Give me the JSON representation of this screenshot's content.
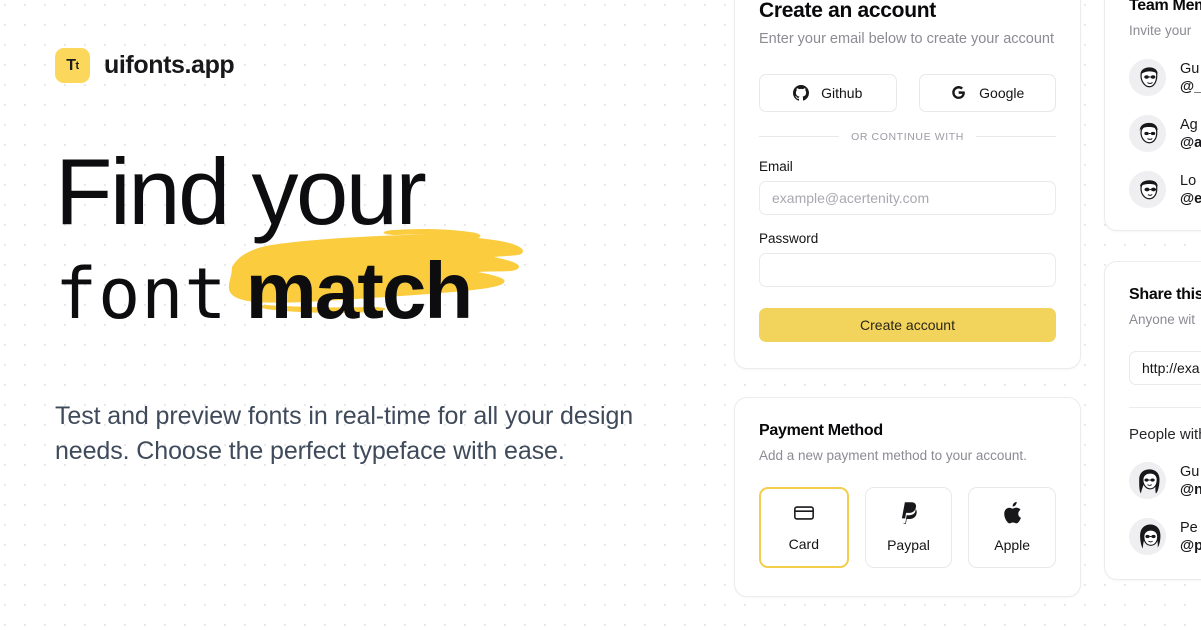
{
  "brand": {
    "mark_letter_1": "T",
    "mark_letter_2": "t",
    "name": "uifonts.app"
  },
  "hero": {
    "headline_line1": "Find your",
    "headline_word_font": "font",
    "headline_word_match": "match",
    "subtitle": "Test and preview fonts in real-time for all your design needs. Choose the perfect typeface with ease."
  },
  "signup_card": {
    "title": "Create an account",
    "description": "Enter your email below to create your account",
    "oauth": [
      {
        "label": "Github",
        "icon": "github-icon"
      },
      {
        "label": "Google",
        "icon": "google-icon"
      }
    ],
    "divider_label": "OR CONTINUE WITH",
    "email_label": "Email",
    "email_placeholder": "example@acertenity.com",
    "email_value": "",
    "password_label": "Password",
    "password_placeholder": "",
    "password_value": "",
    "submit_label": "Create account"
  },
  "payment_card": {
    "title": "Payment Method",
    "description": "Add a new payment method to your account.",
    "options": [
      {
        "label": "Card",
        "icon": "credit-card-icon",
        "selected": true
      },
      {
        "label": "Paypal",
        "icon": "paypal-icon",
        "selected": false
      },
      {
        "label": "Apple",
        "icon": "apple-icon",
        "selected": false
      }
    ]
  },
  "team_card": {
    "title": "Team Mem",
    "description": "Invite your",
    "members": [
      {
        "name": "Gu",
        "handle": "@_"
      },
      {
        "name": "Ag",
        "handle": "@a"
      },
      {
        "name": "Lo",
        "handle": "@e"
      }
    ]
  },
  "share_card": {
    "title": "Share this",
    "description": "Anyone wit",
    "link_value": "http://exa",
    "people_label": "People with",
    "people": [
      {
        "name": "Gu",
        "handle": "@n"
      },
      {
        "name": "Pe",
        "handle": "@p"
      }
    ]
  },
  "colors": {
    "brand_yellow": "#FBD75B",
    "highlight_yellow": "#FACC3E",
    "button_yellow": "#F2D45C",
    "selected_border": "#F2CE4C",
    "text_dark": "#09090b",
    "text_muted": "#8b8b93",
    "subtitle": "#3f4a5a"
  }
}
